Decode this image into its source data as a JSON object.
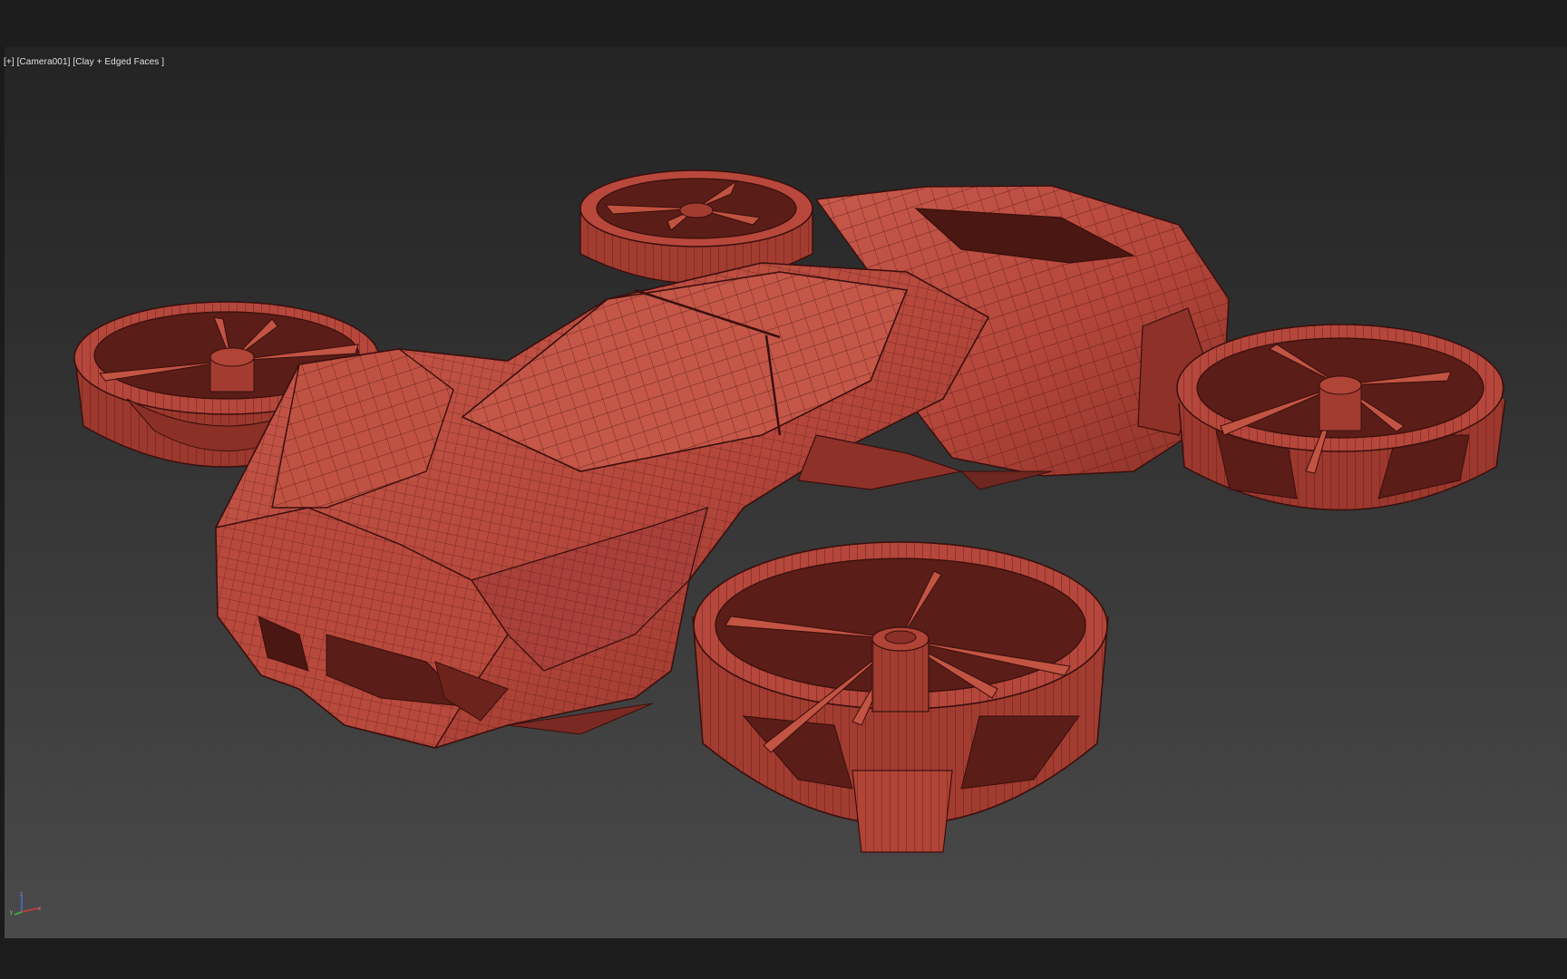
{
  "viewport": {
    "plus_menu": "[+]",
    "camera": "[Camera001]",
    "shading": "[Clay + Edged Faces ]"
  },
  "axis": {
    "x": "x",
    "y": "y",
    "z": "z"
  },
  "colors": {
    "clay": "#b5473c",
    "clay_light": "#d06a5c",
    "clay_dark": "#6e2620",
    "wire": "#3a0f0c",
    "axis_x": "#d03a3a",
    "axis_y": "#3ab84a",
    "axis_z": "#4a6ad8"
  }
}
